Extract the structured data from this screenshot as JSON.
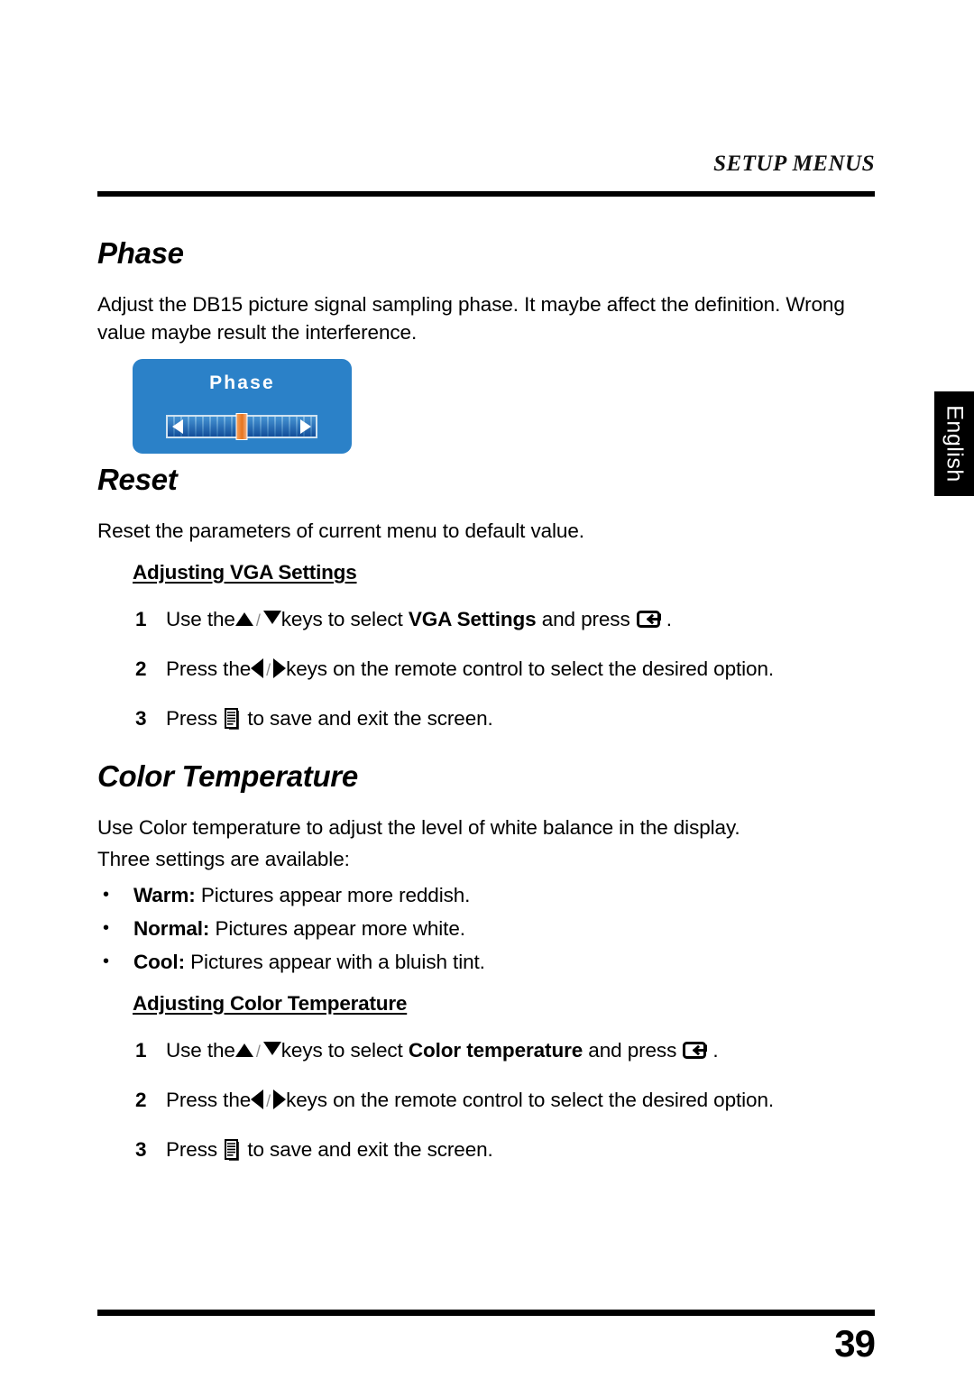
{
  "header": {
    "running_title": "SETUP MENUS"
  },
  "sections": [
    {
      "title": "Phase",
      "paragraph": "Adjust the DB15 picture signal sampling phase. It maybe affect the definition. Wrong value maybe result the interference.",
      "osd": {
        "title": "Phase",
        "control": "slider",
        "left_arrow_icon": "triangle-left-icon",
        "right_arrow_icon": "triangle-right-icon",
        "handle_icon": "slider-handle",
        "background_color": "#2b81c8",
        "handle_color": "#e8741f"
      }
    },
    {
      "title": "Reset",
      "paragraph": "Reset the parameters of current menu to default value.",
      "sub_head": "Adjusting VGA Settings",
      "steps": [
        {
          "num": "1",
          "parts": [
            {
              "type": "text",
              "value": "Use the"
            },
            {
              "type": "icon",
              "value": "triangle-up-icon"
            },
            {
              "type": "text",
              "value": "/"
            },
            {
              "type": "icon",
              "value": "triangle-down-icon"
            },
            {
              "type": "text",
              "value": "keys to select "
            },
            {
              "type": "bold",
              "value": "VGA Settings"
            },
            {
              "type": "text",
              "value": " and press "
            },
            {
              "type": "icon",
              "value": "enter-key-icon"
            },
            {
              "type": "text",
              "value": "."
            }
          ]
        },
        {
          "num": "2",
          "parts": [
            {
              "type": "text",
              "value": "Press the"
            },
            {
              "type": "icon",
              "value": "triangle-left-icon"
            },
            {
              "type": "text",
              "value": "/"
            },
            {
              "type": "icon",
              "value": "triangle-right-icon"
            },
            {
              "type": "text",
              "value": "keys on the remote control to select the desired option."
            }
          ]
        },
        {
          "num": "3",
          "parts": [
            {
              "type": "text",
              "value": "Press "
            },
            {
              "type": "icon",
              "value": "menu-key-icon"
            },
            {
              "type": "text",
              "value": " to save and exit the screen."
            }
          ]
        }
      ]
    },
    {
      "title": "Color Temperature",
      "paragraph": "Use Color temperature to adjust the level of white balance in the display.",
      "paragraph2": "Three settings are available:",
      "bullets": [
        {
          "label": "Warm:",
          "text": " Pictures appear more reddish."
        },
        {
          "label": "Normal:",
          "text": " Pictures appear more white."
        },
        {
          "label": "Cool:",
          "text": " Pictures appear with a bluish tint."
        }
      ],
      "sub_head": "Adjusting Color Temperature",
      "steps": [
        {
          "num": "1",
          "parts": [
            {
              "type": "text",
              "value": "Use the"
            },
            {
              "type": "icon",
              "value": "triangle-up-icon"
            },
            {
              "type": "text",
              "value": "/"
            },
            {
              "type": "icon",
              "value": "triangle-down-icon"
            },
            {
              "type": "text",
              "value": "keys to select "
            },
            {
              "type": "bold",
              "value": "Color temperature"
            },
            {
              "type": "text",
              "value": " and press "
            },
            {
              "type": "icon",
              "value": "enter-key-icon"
            },
            {
              "type": "text",
              "value": "."
            }
          ]
        },
        {
          "num": "2",
          "parts": [
            {
              "type": "text",
              "value": "Press the"
            },
            {
              "type": "icon",
              "value": "triangle-left-icon"
            },
            {
              "type": "text",
              "value": "/"
            },
            {
              "type": "icon",
              "value": "triangle-right-icon"
            },
            {
              "type": "text",
              "value": "keys on the remote control to select the desired option."
            }
          ]
        },
        {
          "num": "3",
          "parts": [
            {
              "type": "text",
              "value": "Press "
            },
            {
              "type": "icon",
              "value": "menu-key-icon"
            },
            {
              "type": "text",
              "value": " to save and exit the screen."
            }
          ]
        }
      ]
    }
  ],
  "language_tab": {
    "label": "English"
  },
  "footer": {
    "page_number": "39"
  },
  "step_labels": {
    "use_the": "Use the",
    "press_the": "Press the",
    "press": "Press ",
    "keys_select": "keys to select ",
    "and_press": " and press ",
    "period": ".",
    "keys_remote": "keys on the remote control to select the desired option.",
    "save_exit": " to save and exit the screen.",
    "slash": "/",
    "vga_settings": "VGA Settings",
    "color_temperature": "Color temperature"
  }
}
